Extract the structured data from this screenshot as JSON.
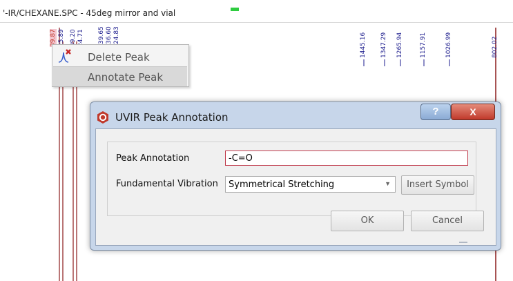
{
  "window": {
    "file_title": "'-IR/CHEXANE.SPC - 45deg mirror and vial"
  },
  "spectrum": {
    "peak_labels_left": [
      "39.87",
      "25.89",
      "39.20",
      "24.71",
      "39.65",
      "36.60",
      "24.83"
    ],
    "peak_labels_right": [
      "1445.16",
      "1347.29",
      "1265.94",
      "1157.91",
      "1026.99",
      "802.02"
    ],
    "selected_peak": "39.87",
    "colors": {
      "line": "#8b1a1a",
      "label": "#1a1a8c",
      "selected_highlight": "#f3c6cf"
    }
  },
  "context_menu": {
    "items": [
      {
        "label": "Delete Peak",
        "icon": "delete-peak-icon"
      },
      {
        "label": "Annotate Peak",
        "icon": ""
      }
    ]
  },
  "dialog": {
    "title": "UVIR Peak Annotation",
    "help_label": "?",
    "close_label": "X",
    "peak_annotation_label": "Peak Annotation",
    "peak_annotation_value": "-C=O",
    "fundamental_vibration_label": "Fundamental Vibration",
    "fundamental_vibration_value": "Symmetrical Stretching",
    "insert_symbol_label": "Insert Symbol",
    "ok_label": "OK",
    "cancel_label": "Cancel",
    "colors": {
      "title_bar": "#c7d6ea",
      "close": "#c0392b",
      "app_icon": "#c0392b"
    }
  }
}
